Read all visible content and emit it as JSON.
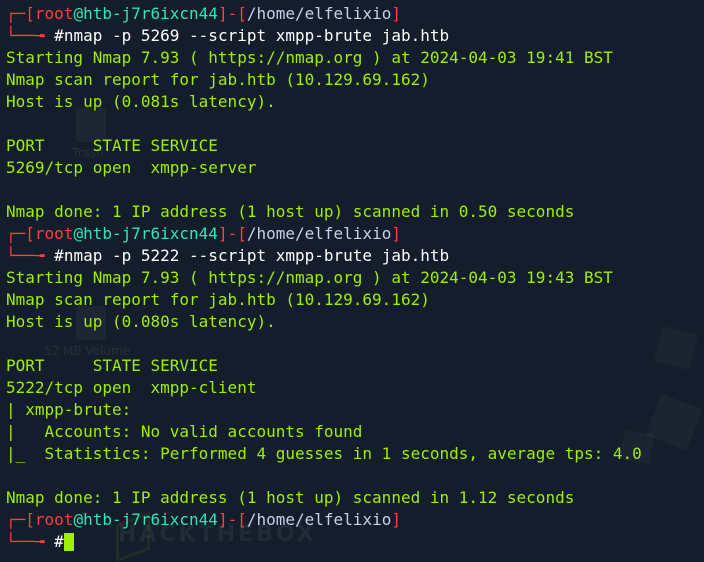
{
  "watermark": "HACKTHEBOX",
  "desktop_labels": [
    "Trash",
    "52 MB Volume"
  ],
  "prompt": {
    "bracket_open": "[",
    "user": "root",
    "at": "@",
    "host": "htb-j7r6ixcn44",
    "sep": "]-[",
    "path": "/home/elfelixio",
    "bracket_close": "]",
    "prefix_top": "┌─",
    "prefix_bottom": "└──╼ ",
    "hash": "#"
  },
  "blocks": [
    {
      "command": "nmap -p 5269 --script xmpp-brute jab.htb",
      "output": [
        "Starting Nmap 7.93 ( https://nmap.org ) at 2024-04-03 19:41 BST",
        "Nmap scan report for jab.htb (10.129.69.162)",
        "Host is up (0.081s latency).",
        "",
        "PORT     STATE SERVICE",
        "5269/tcp open  xmpp-server",
        "",
        "Nmap done: 1 IP address (1 host up) scanned in 0.50 seconds"
      ]
    },
    {
      "command": "nmap -p 5222 --script xmpp-brute jab.htb",
      "output": [
        "Starting Nmap 7.93 ( https://nmap.org ) at 2024-04-03 19:43 BST",
        "Nmap scan report for jab.htb (10.129.69.162)",
        "Host is up (0.080s latency).",
        "",
        "PORT     STATE SERVICE",
        "5222/tcp open  xmpp-client",
        "| xmpp-brute:",
        "|   Accounts: No valid accounts found",
        "|_  Statistics: Performed 4 guesses in 1 seconds, average tps: 4.0",
        "",
        "Nmap done: 1 IP address (1 host up) scanned in 1.12 seconds"
      ]
    }
  ],
  "colors": {
    "background": "#141d2b",
    "output": "#9fef00",
    "prompt_bracket": "#ff3e3e",
    "hostname": "#2ee7b6",
    "path": "#c5d1eb",
    "command": "#ffffff"
  }
}
